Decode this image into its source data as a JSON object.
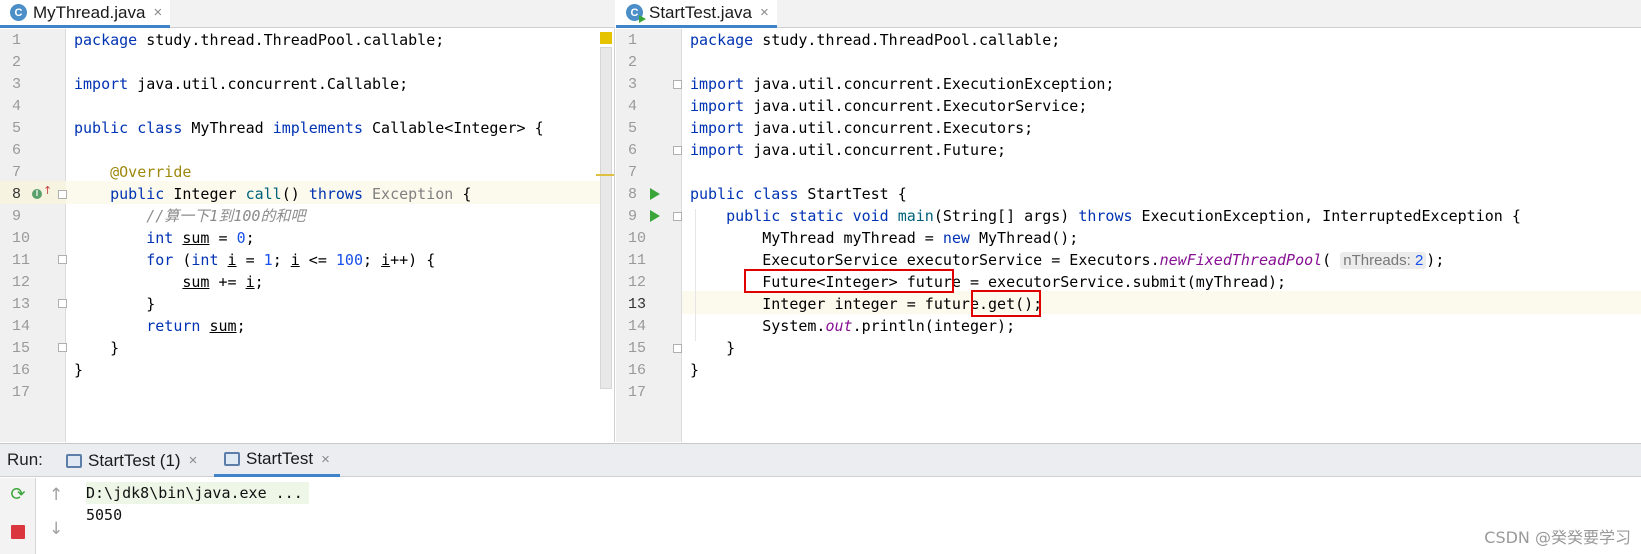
{
  "tabs": {
    "left": {
      "label": "MyThread.java",
      "close": "×",
      "icon": "java-class-icon",
      "icon_letter": "C"
    },
    "right": {
      "label": "StartTest.java",
      "close": "×",
      "icon": "java-runnable-class-icon",
      "icon_letter": "C"
    }
  },
  "left_editor": {
    "line_numbers": [
      "1",
      "2",
      "3",
      "4",
      "5",
      "6",
      "7",
      "8",
      "9",
      "10",
      "11",
      "12",
      "13",
      "14",
      "15",
      "16",
      "17"
    ],
    "code": {
      "l1_kw": "package",
      "l1_rest": " study.thread.ThreadPool.callable;",
      "l3_kw": "import",
      "l3_rest": " java.util.concurrent.Callable;",
      "l5_kw1": "public",
      "l5_kw2": "class",
      "l5_name": " MyThread ",
      "l5_kw3": "implements",
      "l5_rest": " Callable<Integer> {",
      "l7_ann": "@Override",
      "l8_kw1": "public",
      "l8_type": " Integer ",
      "l8_name": "call",
      "l8_parens": "() ",
      "l8_kw2": "throws",
      "l8_exc": "Exception",
      "l8_brace": " {",
      "l9_cmt": "//算一下1到100的和吧",
      "l10_kw": "int",
      "l10_var": "sum",
      "l10_eq": " = ",
      "l10_num": "0",
      "l10_semi": ";",
      "l11_kw1": "for",
      "l11_p": " (",
      "l11_kw2": "int",
      "l11_i1": "i",
      "l11_a": " = ",
      "l11_n1": "1",
      "l11_b": "; ",
      "l11_i2": "i",
      "l11_c": " <= ",
      "l11_n2": "100",
      "l11_d": "; ",
      "l11_i3": "i",
      "l11_e": "++) {",
      "l12_sum": "sum",
      "l12_op": " += ",
      "l12_i": "i",
      "l12_semi": ";",
      "l13": "}",
      "l14_kw": "return",
      "l14_var": "sum",
      "l14_semi": ";",
      "l15": "}",
      "l16": "}"
    }
  },
  "right_editor": {
    "line_numbers": [
      "1",
      "2",
      "3",
      "4",
      "5",
      "6",
      "7",
      "8",
      "9",
      "10",
      "11",
      "12",
      "13",
      "14",
      "15",
      "16",
      "17"
    ],
    "code": {
      "l1_kw": "package",
      "l1_rest": " study.thread.ThreadPool.callable;",
      "l3_kw": "import",
      "l3_rest": " java.util.concurrent.ExecutionException;",
      "l4_kw": "import",
      "l4_rest": " java.util.concurrent.ExecutorService;",
      "l5_kw": "import",
      "l5_rest": " java.util.concurrent.Executors;",
      "l6_kw": "import",
      "l6_rest": " java.util.concurrent.Future;",
      "l8_kw1": "public",
      "l8_kw2": "class",
      "l8_rest": " StartTest {",
      "l9_kw1": "public",
      "l9_kw2": "static",
      "l9_kw3": "void",
      "l9_name": "main",
      "l9_args": "(String[] args) ",
      "l9_kw4": "throws",
      "l9_rest": " ExecutionException, InterruptedException {",
      "l10_a": "MyThread myThread = ",
      "l10_kw": "new",
      "l10_b": " MyThread();",
      "l11_a": "ExecutorService executorService = Executors.",
      "l11_static": "newFixedThreadPool",
      "l11_p": "(",
      "l11_hint": "nThreads:",
      "l11_num": "2",
      "l11_end": ");",
      "l12_a": "Future<Integer> future",
      "l12_b": " = executorService.submit(myThread);",
      "l13_a": "Integer integer = future",
      "l13_b": ".get();",
      "l14_a": "System.",
      "l14_static": "out",
      "l14_b": ".println(integer);",
      "l15": "}",
      "l16": "}"
    }
  },
  "run_panel": {
    "label": "Run:",
    "tabs": [
      {
        "label": "StartTest (1)",
        "close": "×",
        "active": false
      },
      {
        "label": "StartTest",
        "close": "×",
        "active": true
      }
    ],
    "console": [
      "D:\\jdk8\\bin\\java.exe ...",
      "5050"
    ]
  },
  "watermark": "CSDN @癸癸要学习",
  "colors": {
    "keyword": "#0033b3",
    "annotation": "#9e880d",
    "number": "#1750eb",
    "highlight_box": "#e00000",
    "run_green": "#3aa63a",
    "stop_red": "#d9363e"
  }
}
